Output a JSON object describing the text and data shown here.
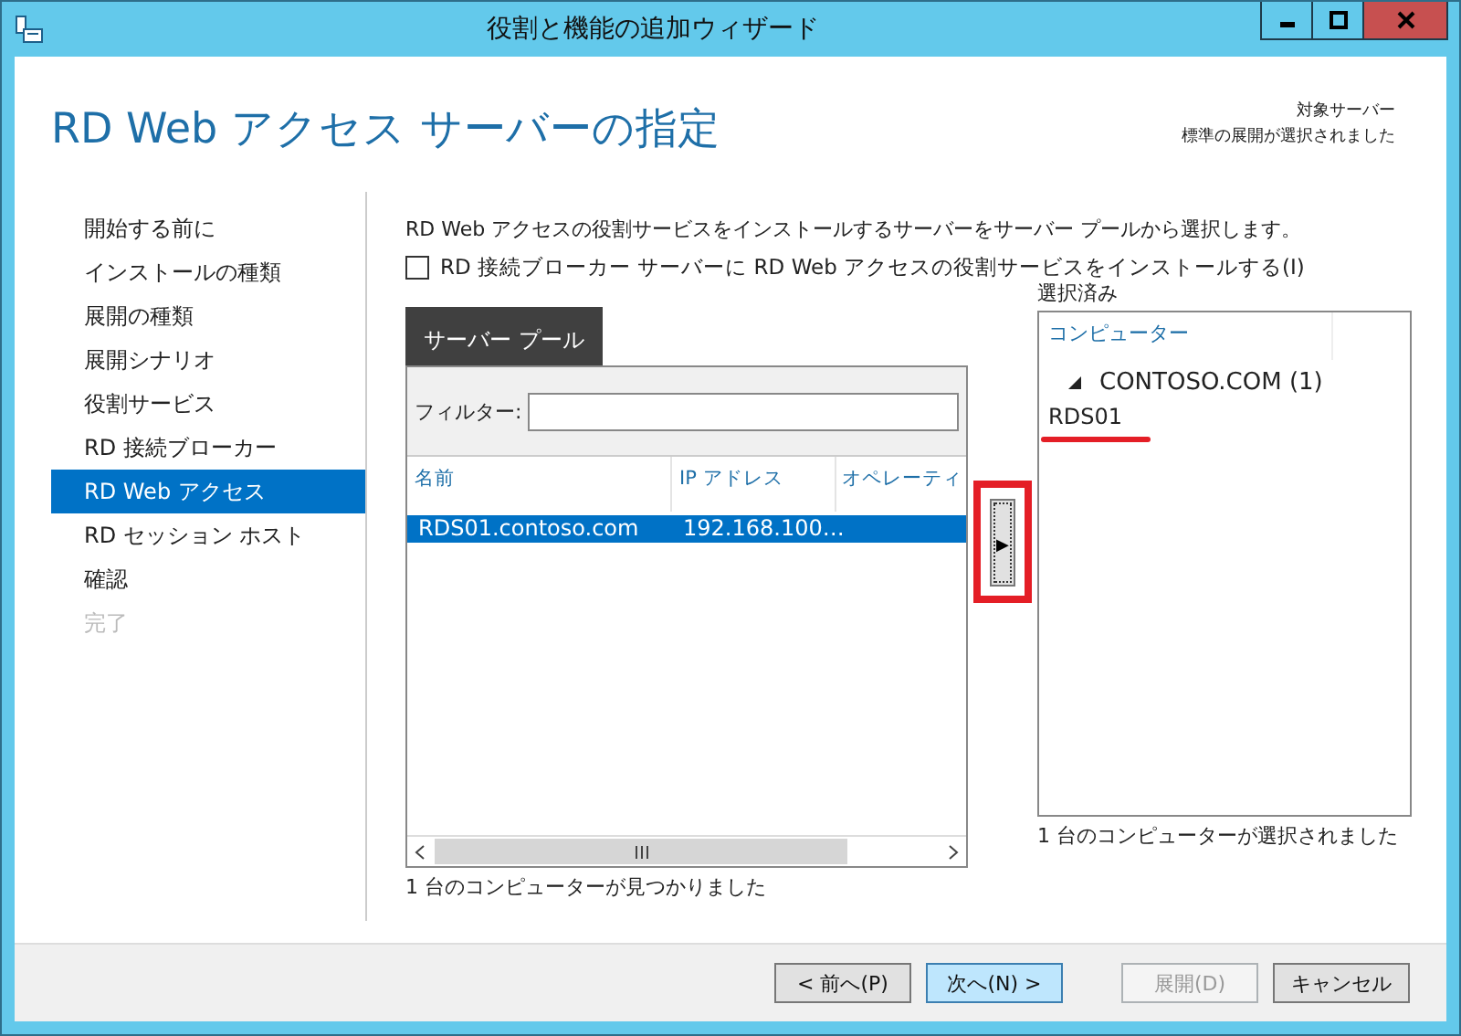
{
  "window": {
    "title": "役割と機能の追加ウィザード"
  },
  "header": {
    "title": "RD Web アクセス サーバーの指定",
    "target_label": "対象サーバー",
    "target_value": "標準の展開が選択されました"
  },
  "sidebar": {
    "items": [
      {
        "label": "開始する前に",
        "selected": false,
        "disabled": false
      },
      {
        "label": "インストールの種類",
        "selected": false,
        "disabled": false
      },
      {
        "label": "展開の種類",
        "selected": false,
        "disabled": false
      },
      {
        "label": "展開シナリオ",
        "selected": false,
        "disabled": false
      },
      {
        "label": "役割サービス",
        "selected": false,
        "disabled": false
      },
      {
        "label": "RD 接続ブローカー",
        "selected": false,
        "disabled": false
      },
      {
        "label": "RD Web アクセス",
        "selected": true,
        "disabled": false
      },
      {
        "label": "RD セッション ホスト",
        "selected": false,
        "disabled": false
      },
      {
        "label": "確認",
        "selected": false,
        "disabled": false
      },
      {
        "label": "完了",
        "selected": false,
        "disabled": true
      }
    ]
  },
  "description": "RD Web アクセスの役割サービスをインストールするサーバーをサーバー プールから選択します。",
  "install_on_broker": {
    "label": "RD 接続ブローカー サーバーに RD Web アクセスの役割サービスをインストールする(I)",
    "checked": false
  },
  "server_pool": {
    "tab": "サーバー プール",
    "filter_label": "フィルター:",
    "columns": [
      "名前",
      "IP アドレス",
      "オペレーティ"
    ],
    "rows": [
      {
        "cells": [
          "RDS01.contoso.com",
          "192.168.100…"
        ],
        "selected": true
      }
    ],
    "status": "1 台のコンピューターが見つかりました"
  },
  "add_button": {
    "label": "▶",
    "highlighted": true
  },
  "selected_panel": {
    "title": "選択済み",
    "column": "コンピューター",
    "groups": [
      {
        "label": "CONTOSO.COM (1)",
        "expanded": true,
        "children": [
          {
            "label": "RDS01",
            "underlined": true
          }
        ]
      }
    ],
    "status": "1 台のコンピューターが選択されました"
  },
  "buttons": [
    {
      "label": "< 前へ(P)",
      "kind": "normal",
      "disabled": false
    },
    {
      "label": "次へ(N) >",
      "kind": "default",
      "disabled": false
    },
    {
      "label": "展開(D)",
      "kind": "normal",
      "disabled": true
    },
    {
      "label": "キャンセル",
      "kind": "normal",
      "disabled": false
    }
  ]
}
